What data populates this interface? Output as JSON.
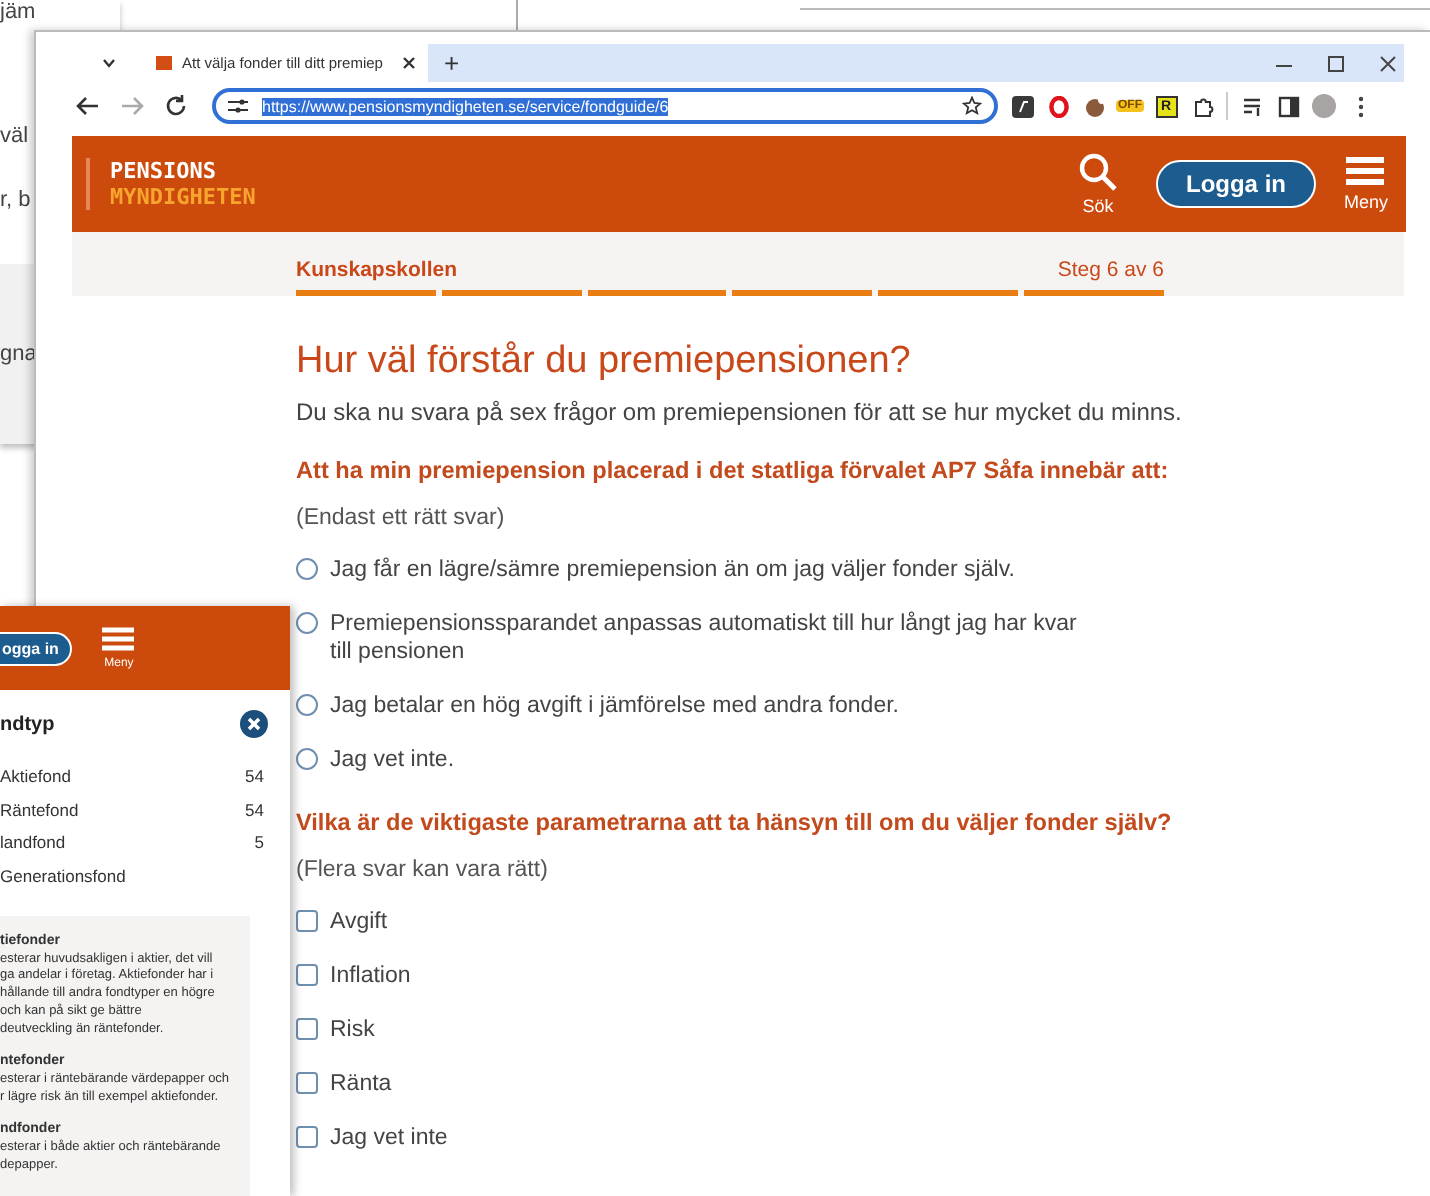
{
  "background_window": {
    "lines": [
      "jäm",
      "väl",
      "r, b",
      "gna"
    ]
  },
  "browser": {
    "tab": {
      "title": "Att välja fonder till ditt premiep",
      "selected": true
    },
    "new_tab": "+",
    "url": "https://www.pensionsmyndigheten.se/service/fondguide/6",
    "url_selected": true,
    "extension_badges": [
      "OFF",
      "R"
    ]
  },
  "site_header": {
    "logo": [
      "PENSIONS",
      "MYNDIGHETEN"
    ],
    "search_label": "Sök",
    "login": "Logga in",
    "menu_label": "Meny"
  },
  "progress": {
    "title": "Kunskapskollen",
    "step_label": "Steg 6 av 6",
    "steps": [
      {
        "done": true
      },
      {
        "done": true
      },
      {
        "done": true
      },
      {
        "done": true
      },
      {
        "done": true
      },
      {
        "done": true
      }
    ]
  },
  "quiz": {
    "heading": "Hur väl förstår du premiepensionen?",
    "intro": "Du ska nu svara på sex frågor om premiepensionen för att se hur mycket du minns.",
    "questions": [
      {
        "kind": "single",
        "text": "Att ha min premiepension placerad i det statliga förvalet AP7 Såfa innebär att:",
        "hint": "(Endast ett rätt svar)",
        "options": [
          {
            "label": "Jag får en lägre/sämre premiepension än om jag väljer fonder själv.",
            "selected": false
          },
          {
            "label": "Premiepensionssparandet anpassas automatiskt till hur långt jag har kvar till pensionen",
            "selected": false
          },
          {
            "label": "Jag betalar en hög avgift i jämförelse med andra fonder.",
            "selected": false
          },
          {
            "label": "Jag vet inte.",
            "selected": false
          }
        ]
      },
      {
        "kind": "multiple",
        "text": "Vilka är de viktigaste parametrarna att ta hänsyn till om du väljer fonder själv?",
        "hint": "(Flera svar kan vara rätt)",
        "options": [
          {
            "label": "Avgift",
            "checked": false
          },
          {
            "label": "Inflation",
            "checked": false
          },
          {
            "label": "Risk",
            "checked": false
          },
          {
            "label": "Ränta",
            "checked": false
          },
          {
            "label": "Jag vet inte",
            "checked": false
          }
        ]
      }
    ]
  },
  "filter_panel": {
    "login": "ogga in",
    "menu_label": "Meny",
    "title": "ndtyp",
    "items": [
      {
        "label": "Aktiefond",
        "count": "54"
      },
      {
        "label": "Räntefond",
        "count": "54"
      },
      {
        "label": "landfond",
        "count": "5"
      },
      {
        "label": "Generationsfond"
      }
    ],
    "info": [
      {
        "title": "tiefonder",
        "lines": [
          "esterar huvudsakligen i aktier, det vill",
          "ga andelar i företag. Aktiefonder har i",
          "hållande till andra fondtyper en högre",
          "och kan på sikt ge bättre",
          "deutveckling än räntefonder."
        ]
      },
      {
        "title": "ntefonder",
        "lines": [
          "esterar i räntebärande värdepapper och",
          "r lägre risk än till exempel aktiefonder."
        ]
      },
      {
        "title": "ndfonder",
        "lines": [
          "esterar i både aktier och räntebärande",
          "depapper."
        ]
      }
    ]
  }
}
